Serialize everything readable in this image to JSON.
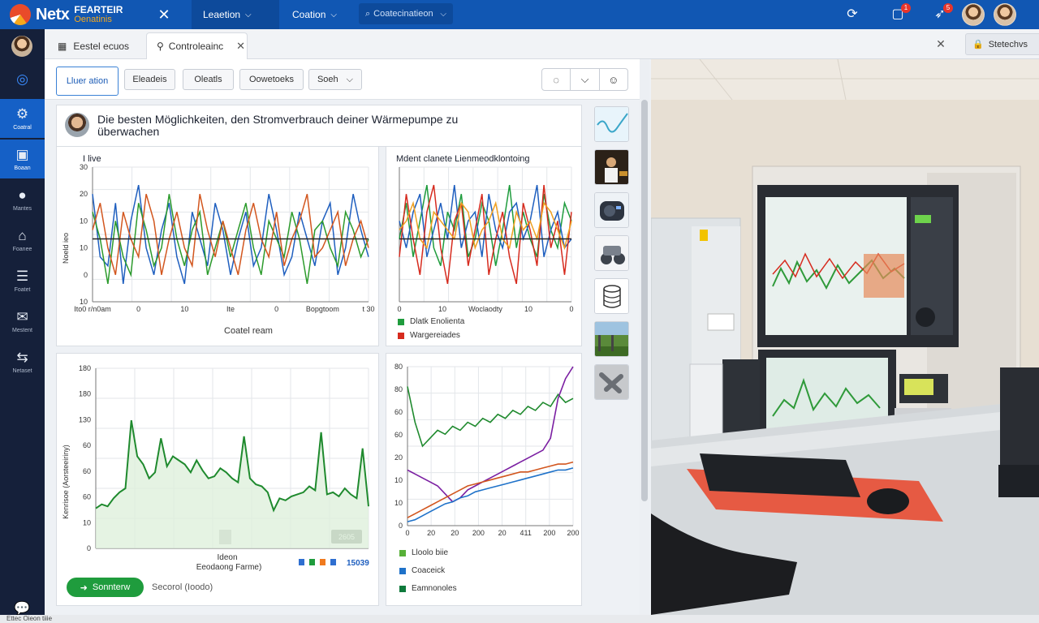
{
  "topbar": {
    "logo_name": "Netx",
    "logo_line1": "FEARTEIR",
    "logo_line2": "Oenatinis",
    "menu": [
      {
        "label": "Leaetion"
      },
      {
        "label": "Coation"
      }
    ],
    "search_placeholder": "Coatecinatieon",
    "badges": [
      "1",
      "5"
    ],
    "colors": {
      "bar": "#1157b3",
      "accent": "#f6a81c",
      "badge": "#e8352a"
    }
  },
  "sidebar": {
    "items": [
      {
        "label": "",
        "icon": "globe-icon"
      },
      {
        "label": "Coatral",
        "icon": "gear-icon"
      },
      {
        "label": "Boaan",
        "icon": "monitor-icon"
      },
      {
        "label": "Mantes",
        "icon": "circle-icon"
      },
      {
        "label": "Foanee",
        "icon": "home-icon"
      },
      {
        "label": "Foatet",
        "icon": "database-icon"
      },
      {
        "label": "Mestent",
        "icon": "mail-icon"
      },
      {
        "label": "Netaset",
        "icon": "share-icon"
      }
    ]
  },
  "tabs": {
    "tab1": "Eestel ecuos",
    "tab2": "Controleainc",
    "right_search": "Stetechvs"
  },
  "filters": {
    "buttons": [
      "Lluer ation",
      "Eleadeis",
      "Oleatls",
      "Oowetoeks",
      "Soeh"
    ]
  },
  "post": {
    "title": "Die besten Möglichkeiten, den Stromverbrauch deiner Wärmepumpe zu überwachen"
  },
  "chart1": {
    "title": "I live",
    "ylabel": "Noeld ieo",
    "xlabel": "Coatel ream",
    "yticks": [
      "30",
      "20",
      "10",
      "10",
      "0",
      "10"
    ],
    "xticks": [
      "Ito0 r/n0am",
      "0",
      "10",
      "Ite",
      "0",
      "Bopgtoom",
      "t 30"
    ]
  },
  "chart2": {
    "title": "Mdent clanete Lienmeodklontoing",
    "xticks": [
      "0",
      "10",
      "Woclaodty",
      "10",
      "0"
    ],
    "legend": [
      {
        "label": "Dlatk Enolienta",
        "color": "#1f9c3d"
      },
      {
        "label": "Wargereiades",
        "color": "#d62b1e"
      }
    ]
  },
  "chart3": {
    "ylabel": "Kenrisoe (Aorsteeiriny)",
    "yticks": [
      "180",
      "180",
      "130",
      "60",
      "60",
      "60",
      "10",
      "0"
    ],
    "xlabel_line1": "Ideon",
    "xlabel_line2": "Eeodaong Farme)",
    "value_box": "2605",
    "bottom_value": "15039"
  },
  "chart4": {
    "yticks": [
      "80",
      "80",
      "60",
      "60",
      "20",
      "10",
      "10",
      "0"
    ],
    "xticks": [
      "0",
      "20",
      "20",
      "200",
      "20",
      "411",
      "200",
      "200"
    ],
    "legend": [
      {
        "label": "Lloolo biie",
        "color": "#57b038"
      },
      {
        "label": "Coaceick",
        "color": "#1f72c9"
      },
      {
        "label": "Eamnonoles",
        "color": "#0f7a3c"
      }
    ]
  },
  "footer": {
    "primary_button": "Sonnterw",
    "secondary_text": "Secorol (Ioodo)"
  },
  "status": {
    "text": "Ettec Oieon tiiie"
  },
  "chart_data": [
    {
      "type": "line",
      "title": "I live",
      "ylabel": "Noeld ieo",
      "xlabel": "Coatel ream",
      "series": [
        {
          "color": "#1f5fbf",
          "values": [
            24,
            10,
            8,
            22,
            4,
            18,
            26,
            12,
            6,
            16,
            22,
            10,
            4,
            20,
            14,
            8,
            22,
            16,
            6,
            14,
            20,
            8,
            12,
            24,
            16,
            6,
            10,
            20,
            14,
            8,
            18,
            22,
            6,
            12,
            24,
            16,
            10
          ]
        },
        {
          "color": "#2c9b2c",
          "values": [
            20,
            14,
            4,
            18,
            10,
            6,
            22,
            16,
            8,
            12,
            24,
            14,
            8,
            16,
            20,
            6,
            12,
            18,
            10,
            16,
            22,
            12,
            6,
            18,
            14,
            10,
            20,
            14,
            4,
            16,
            18,
            12,
            8,
            20,
            16,
            10,
            14
          ]
        },
        {
          "color": "#d2561e",
          "values": [
            16,
            22,
            12,
            6,
            20,
            14,
            10,
            24,
            18,
            6,
            14,
            20,
            12,
            8,
            24,
            16,
            10,
            18,
            12,
            6,
            16,
            22,
            14,
            10,
            20,
            8,
            14,
            18,
            24,
            10,
            12,
            16,
            20,
            8,
            14,
            18,
            12
          ]
        },
        {
          "color": "#222222",
          "values": [
            14,
            14,
            14,
            14,
            14,
            14,
            14,
            14,
            14,
            14,
            14,
            14,
            14,
            14,
            14,
            14,
            14,
            14,
            14,
            14,
            14,
            14,
            14,
            14,
            14,
            14,
            14,
            14,
            14,
            14,
            14,
            14,
            14,
            14,
            14,
            14,
            14
          ]
        }
      ],
      "ylim": [
        0,
        30
      ]
    },
    {
      "type": "line",
      "title": "Mdent clanete Lienmeodklontoing",
      "series": [
        {
          "color": "#1f9c3d",
          "values": [
            14,
            22,
            10,
            18,
            26,
            12,
            8,
            20,
            16,
            24,
            10,
            14,
            22,
            18,
            8,
            16,
            26,
            12,
            20,
            14,
            10,
            24,
            16,
            12,
            22,
            18
          ]
        },
        {
          "color": "#1f5fbf",
          "values": [
            18,
            12,
            20,
            24,
            10,
            16,
            22,
            14,
            26,
            12,
            18,
            20,
            10,
            24,
            16,
            12,
            20,
            22,
            14,
            18,
            26,
            10,
            16,
            20,
            12,
            14
          ]
        },
        {
          "color": "#d62b1e",
          "values": [
            10,
            24,
            14,
            6,
            20,
            26,
            12,
            4,
            18,
            22,
            8,
            16,
            24,
            6,
            14,
            20,
            10,
            4,
            22,
            16,
            8,
            26,
            12,
            18,
            6,
            20
          ]
        },
        {
          "color": "#f0a020",
          "values": [
            16,
            18,
            22,
            14,
            12,
            20,
            18,
            16,
            14,
            22,
            20,
            12,
            16,
            18,
            22,
            14,
            12,
            20,
            16,
            18,
            14,
            22,
            20,
            16,
            12,
            18
          ]
        },
        {
          "color": "#222222",
          "values": [
            14,
            14,
            14,
            14,
            14,
            14,
            14,
            14,
            14,
            14,
            14,
            14,
            14,
            14,
            14,
            14,
            14,
            14,
            14,
            14,
            14,
            14,
            14,
            14,
            14,
            14
          ]
        }
      ],
      "ylim": [
        0,
        30
      ]
    },
    {
      "type": "area",
      "ylabel": "Kenrisoe (Aorsteeiriny)",
      "series": [
        {
          "color": "#1f8a2e",
          "values": [
            40,
            44,
            42,
            50,
            56,
            60,
            128,
            92,
            84,
            70,
            76,
            110,
            82,
            92,
            88,
            84,
            76,
            88,
            78,
            70,
            72,
            80,
            76,
            70,
            66,
            112,
            70,
            64,
            62,
            56,
            38,
            50,
            48,
            52,
            54,
            56,
            62,
            58,
            116,
            54,
            56,
            52,
            60,
            54,
            50,
            100,
            42
          ]
        }
      ],
      "ylim": [
        0,
        180
      ]
    },
    {
      "type": "line",
      "series": [
        {
          "color": "#1f8a2e",
          "values": [
            70,
            52,
            40,
            44,
            48,
            46,
            50,
            48,
            52,
            50,
            54,
            52,
            56,
            54,
            58,
            56,
            60,
            58,
            62,
            60,
            66,
            62,
            64
          ]
        },
        {
          "color": "#7b1fa2",
          "values": [
            28,
            26,
            24,
            22,
            20,
            16,
            12,
            14,
            18,
            20,
            22,
            24,
            26,
            28,
            30,
            32,
            34,
            36,
            38,
            44,
            64,
            74,
            80
          ]
        },
        {
          "color": "#d2561e",
          "values": [
            4,
            6,
            8,
            10,
            12,
            14,
            16,
            18,
            20,
            21,
            22,
            23,
            24,
            25,
            26,
            27,
            27,
            28,
            29,
            30,
            31,
            31,
            32
          ]
        },
        {
          "color": "#1f72c9",
          "values": [
            2,
            3,
            5,
            7,
            9,
            11,
            12,
            14,
            15,
            17,
            18,
            19,
            20,
            21,
            22,
            23,
            24,
            25,
            26,
            27,
            28,
            28,
            29
          ]
        }
      ],
      "ylim": [
        0,
        80
      ]
    }
  ]
}
